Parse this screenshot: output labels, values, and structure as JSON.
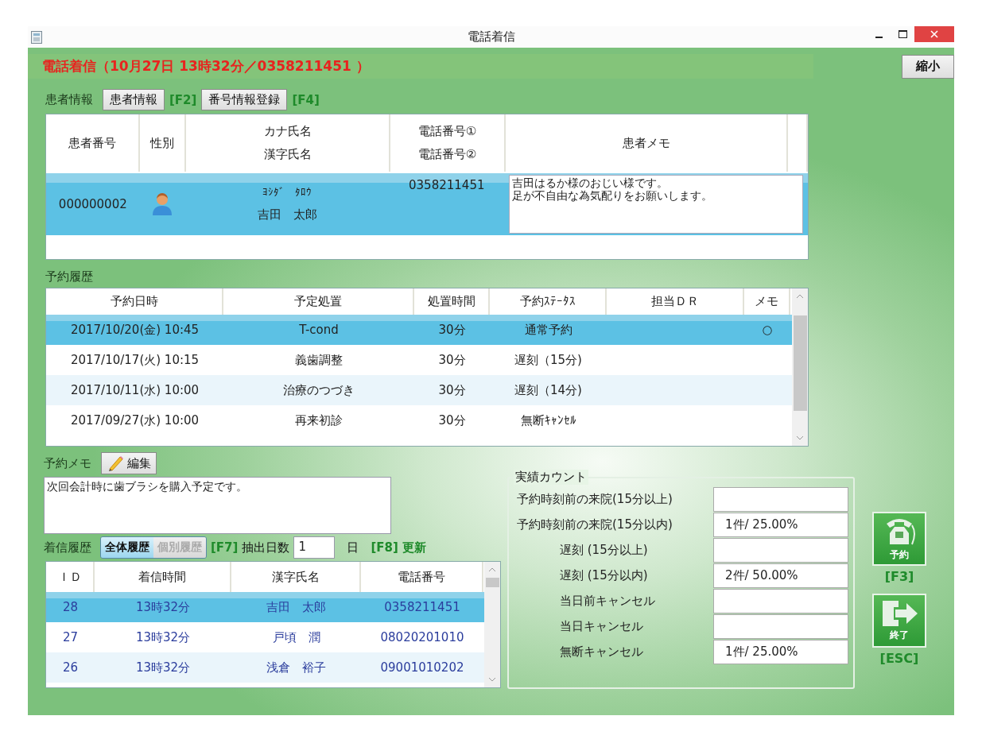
{
  "window": {
    "title": "電話着信"
  },
  "caller_banner": "電話着信（10月27日 13時32分／0358211451 ）",
  "shrink_button": "縮小",
  "patient_section": {
    "label": "患者情報",
    "buttons": [
      {
        "label": "患者情報",
        "key": "[F2]"
      },
      {
        "label": "番号情報登録",
        "key": "[F4]"
      }
    ]
  },
  "patient_table": {
    "columns": [
      {
        "lines": [
          "患者番号"
        ]
      },
      {
        "lines": [
          "性別"
        ]
      },
      {
        "lines": [
          "カナ氏名",
          "漢字氏名"
        ]
      },
      {
        "lines": [
          "電話番号①",
          "電話番号②"
        ]
      },
      {
        "lines": [
          "患者メモ"
        ]
      }
    ],
    "rows": [
      {
        "number": "000000002",
        "gender_icon": true,
        "kana": "ﾖｼﾀﾞ　ﾀﾛｳ",
        "kanji": "吉田　太郎",
        "phone1": "0358211451",
        "memo_lines": [
          "吉田はるか様のおじい様です。",
          "足が不自由な為気配りをお願いします。"
        ],
        "selected": true
      }
    ]
  },
  "reservation_section": {
    "label": "予約履歴"
  },
  "reservation_table": {
    "columns": [
      "予約日時",
      "予定処置",
      "処置時間",
      "予約ｽﾃｰﾀｽ",
      "担当ＤＲ",
      "メモ"
    ],
    "rows": [
      {
        "datetime": "2017/10/20(金) 10:45",
        "treatment": "T-cond",
        "duration": "30分",
        "status": "通常予約",
        "memo": "○",
        "selected": true
      },
      {
        "datetime": "2017/10/17(火) 10:15",
        "treatment": "義歯調整",
        "duration": "30分",
        "status": "遅刻（15分)",
        "selected": false
      },
      {
        "datetime": "2017/10/11(水) 10:00",
        "treatment": "治療のつづき",
        "duration": "30分",
        "status": "遅刻（14分)",
        "selected": false
      },
      {
        "datetime": "2017/09/27(水) 10:00",
        "treatment": "再来初診",
        "duration": "30分",
        "status": "無断ｷｬﾝｾﾙ",
        "selected": false
      }
    ]
  },
  "reservation_memo": {
    "label": "予約メモ",
    "edit_button": "編集",
    "text": "次回会計時に歯ブラシを購入予定です。"
  },
  "call_history": {
    "label": "着信履歴",
    "tabs": [
      {
        "label": "全体履歴",
        "selected": true
      },
      {
        "label": "個別履歴",
        "selected": false
      }
    ],
    "tab_key": "[F7]",
    "days_label": "抽出日数",
    "days_value": "1",
    "days_unit": "日",
    "refresh": "[F8] 更新"
  },
  "call_table": {
    "columns": [
      "ＩＤ",
      "着信時間",
      "漢字氏名",
      "電話番号"
    ],
    "rows": [
      {
        "id": "28",
        "time": "13時32分",
        "name": "吉田　太郎",
        "phone": "0358211451",
        "selected": true
      },
      {
        "id": "27",
        "time": "13時32分",
        "name": "戸頃　潤",
        "phone": "08020201010",
        "selected": false
      },
      {
        "id": "26",
        "time": "13時32分",
        "name": "浅倉　裕子",
        "phone": "09001010202",
        "selected": false
      }
    ]
  },
  "stats": {
    "title": "実績カウント",
    "rows": [
      {
        "kind": "main",
        "label": "予約時刻前の来院(15分以上)"
      },
      {
        "kind": "main",
        "label": "予約時刻前の来院(15分以内)",
        "value": "1件/ 25.00%"
      },
      {
        "kind": "sub",
        "label": "遅刻 (15分以上)"
      },
      {
        "kind": "sub",
        "label": "遅刻 (15分以内)",
        "value": "2件/ 50.00%"
      },
      {
        "kind": "sub",
        "label": "当日前キャンセル"
      },
      {
        "kind": "sub",
        "label": "当日キャンセル"
      },
      {
        "kind": "sub",
        "label": "無断キャンセル",
        "value": "1件/ 25.00%"
      }
    ]
  },
  "side_buttons": [
    {
      "kind": "reserve",
      "label": "予約",
      "key": "[F3]"
    },
    {
      "kind": "exit",
      "label": "終了",
      "key": "[ESC]"
    }
  ]
}
